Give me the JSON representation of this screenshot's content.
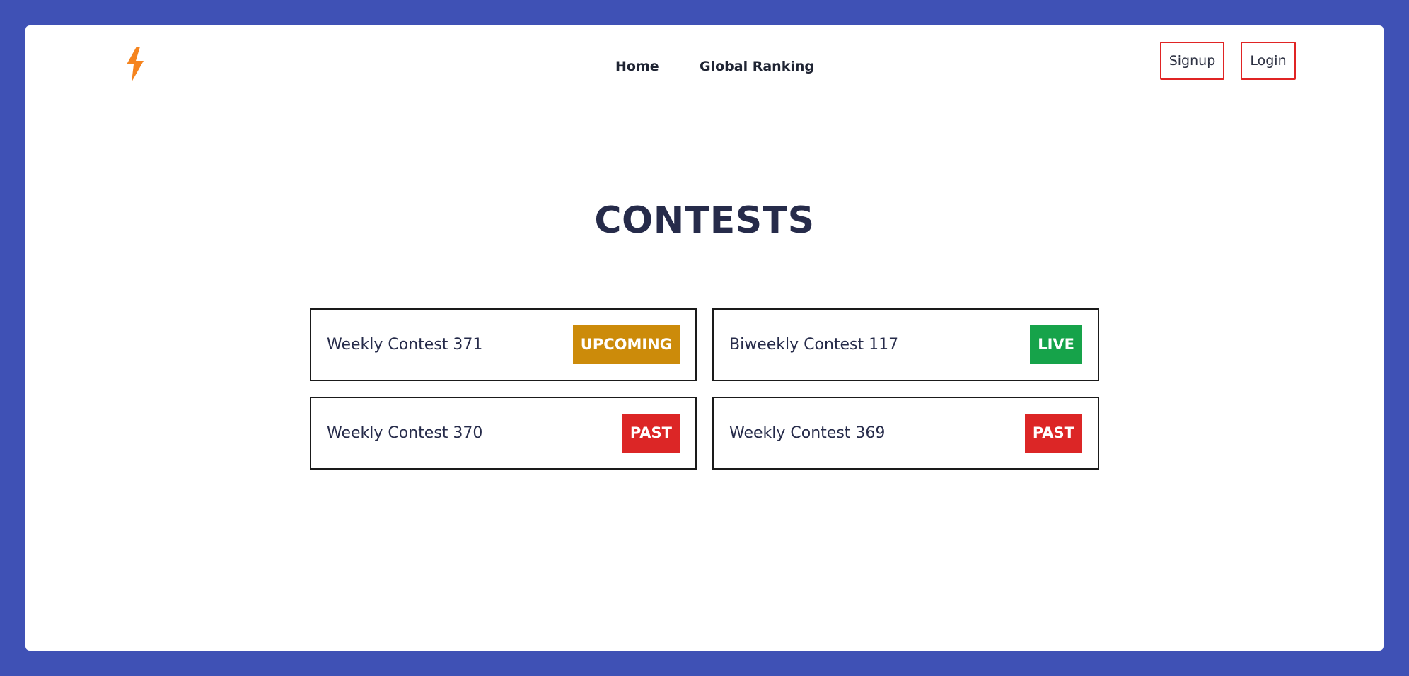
{
  "nav": {
    "logo_icon": "lightning-bolt-icon",
    "logo_color": "#f5841f",
    "links": [
      {
        "label": "Home"
      },
      {
        "label": "Global Ranking"
      }
    ],
    "signup_label": "Signup",
    "login_label": "Login",
    "auth_border_color": "#e02424"
  },
  "main": {
    "title": "CONTESTS",
    "contests": [
      {
        "name": "Weekly Contest 371",
        "status": "UPCOMING",
        "status_color": "#cc8b0a"
      },
      {
        "name": "Biweekly Contest 117",
        "status": "LIVE",
        "status_color": "#16a34a"
      },
      {
        "name": "Weekly Contest 370",
        "status": "PAST",
        "status_color": "#dc2626"
      },
      {
        "name": "Weekly Contest 369",
        "status": "PAST",
        "status_color": "#dc2626"
      }
    ]
  },
  "theme": {
    "background": "#3f51b5",
    "panel": "#ffffff",
    "text_dark": "#262b4a"
  }
}
